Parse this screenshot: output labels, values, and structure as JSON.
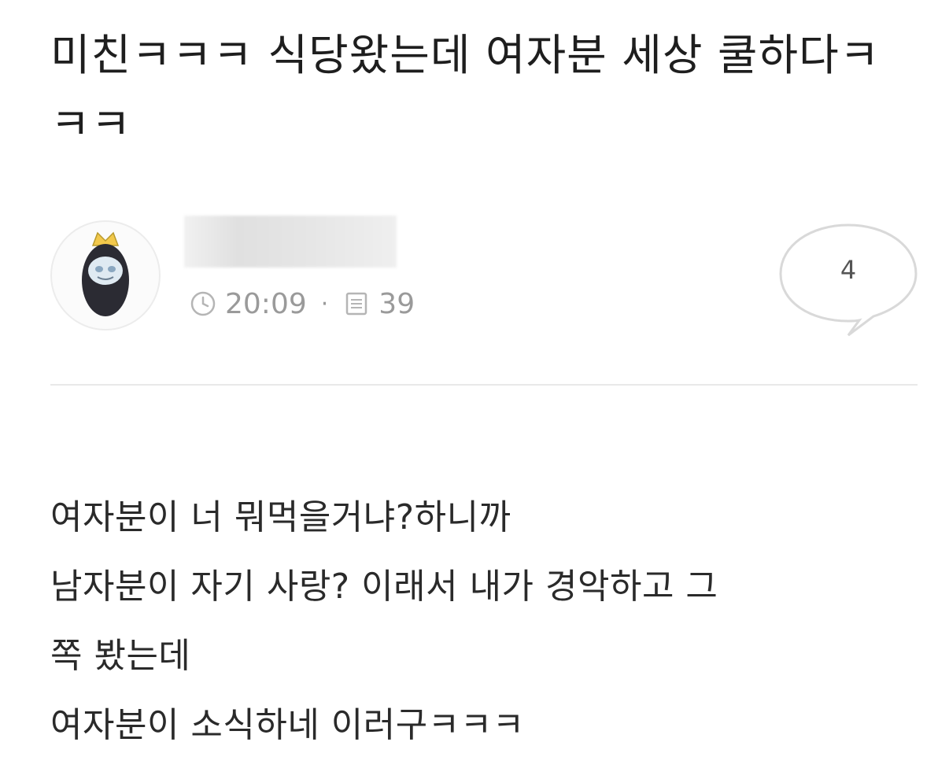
{
  "post": {
    "title": "미친ㅋㅋㅋ 식당왔는데 여자분 세상 쿨하다ㅋㅋㅋ",
    "author": {
      "avatar_icon": "character-avatar-icon"
    },
    "meta": {
      "time": "20:09",
      "time_icon": "clock-icon",
      "views": "39",
      "views_icon": "document-icon"
    },
    "comment_count": "4",
    "comment_icon": "speech-bubble-icon",
    "body_lines": [
      "여자분이 너 뭐먹을거냐?하니까",
      "남자분이 자기 사랑? 이래서 내가 경악하고 그",
      "쪽 봤는데",
      "여자분이 소식하네 이러구ㅋㅋㅋ"
    ]
  }
}
